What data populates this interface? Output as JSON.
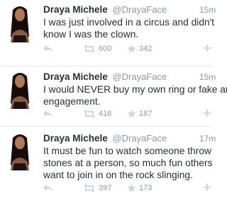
{
  "tweets": [
    {
      "name": "Draya Michele",
      "handle": "@DrayaFace",
      "time": "15m",
      "lines": [
        "I was just involved in a circus and didn't",
        "know I was the clown."
      ],
      "retweets": "600",
      "favorites": "342"
    },
    {
      "name": "Draya Michele",
      "handle": "@DrayaFace",
      "time": "15m",
      "lines": [
        "I would NEVER buy my own ring or fake an",
        "engagement."
      ],
      "retweets": "416",
      "favorites": "187"
    },
    {
      "name": "Draya Michele",
      "handle": "@DrayaFace",
      "time": "17m",
      "lines": [
        "It must be fun to watch someone throw",
        "stones at a person, so much fun others",
        "want to join in on the rock slinging."
      ],
      "retweets": "397",
      "favorites": "173"
    }
  ],
  "icons": {
    "reply": "reply-arrow",
    "retweet": "retweet-arrows",
    "favorite": "star",
    "follow": "follow-plus"
  },
  "colors": {
    "text": "#292f33",
    "muted": "#8899a6",
    "icon": "#ccd6dd",
    "divider": "#e1e8ed"
  }
}
